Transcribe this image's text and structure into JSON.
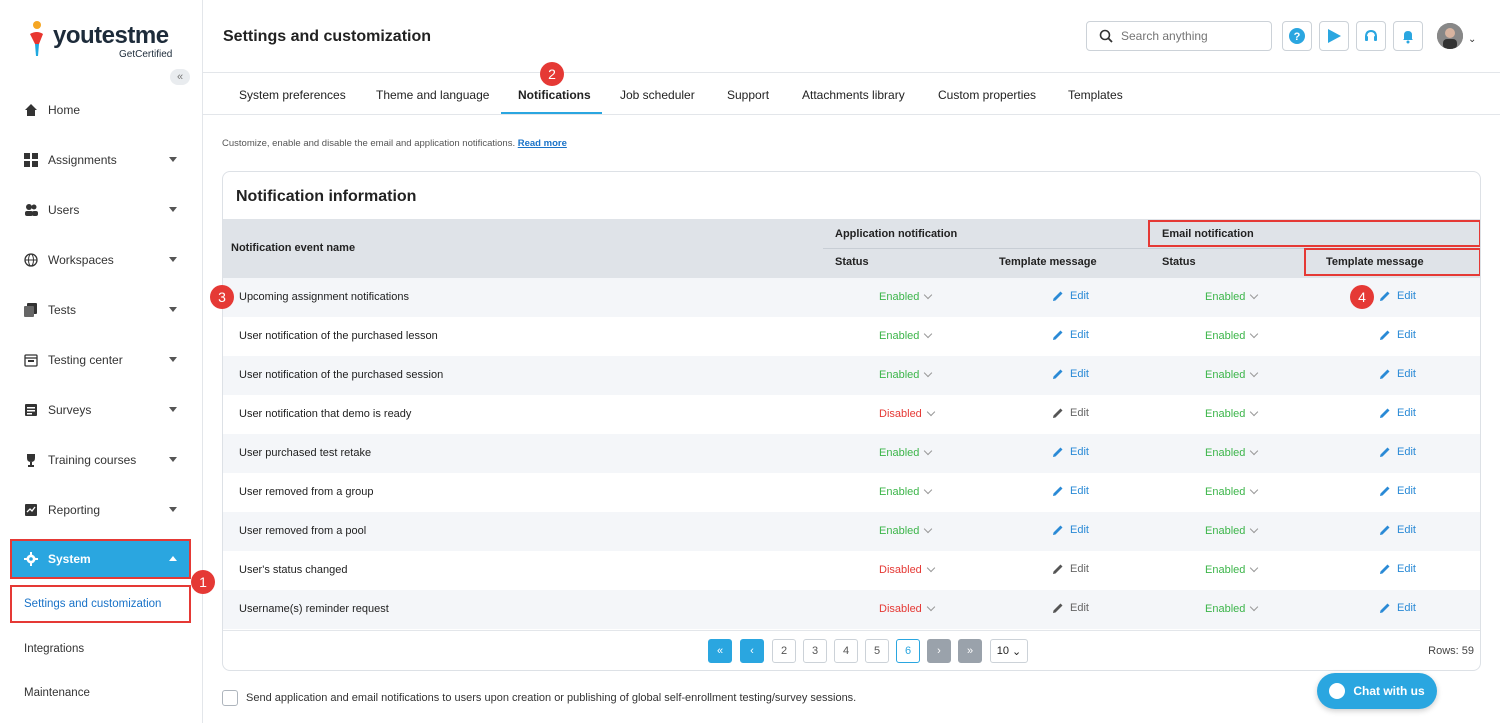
{
  "brand": {
    "name": "youtestme",
    "sub": "GetCertified"
  },
  "header": {
    "title": "Settings and customization",
    "search_placeholder": "Search anything"
  },
  "sidebar": {
    "items": [
      {
        "label": "Home"
      },
      {
        "label": "Assignments"
      },
      {
        "label": "Users"
      },
      {
        "label": "Workspaces"
      },
      {
        "label": "Tests"
      },
      {
        "label": "Testing center"
      },
      {
        "label": "Surveys"
      },
      {
        "label": "Training courses"
      },
      {
        "label": "Reporting"
      },
      {
        "label": "System"
      }
    ],
    "sub_items": [
      {
        "label": "Settings and customization"
      },
      {
        "label": "Integrations"
      },
      {
        "label": "Maintenance"
      }
    ]
  },
  "tabs": [
    {
      "label": "System preferences"
    },
    {
      "label": "Theme and language"
    },
    {
      "label": "Notifications"
    },
    {
      "label": "Job scheduler"
    },
    {
      "label": "Support"
    },
    {
      "label": "Attachments library"
    },
    {
      "label": "Custom properties"
    },
    {
      "label": "Templates"
    }
  ],
  "description": {
    "text": "Customize, enable and disable the email and application notifications. ",
    "link": "Read more"
  },
  "card": {
    "title": "Notification information",
    "columns": {
      "event_name": "Notification event name",
      "app_group": "Application notification",
      "email_group": "Email notification",
      "status": "Status",
      "template": "Template message"
    },
    "edit_label": "Edit",
    "rows": [
      {
        "name": "Upcoming assignment notifications",
        "app_status": "Enabled",
        "email_status": "Enabled"
      },
      {
        "name": "User notification of the purchased lesson",
        "app_status": "Enabled",
        "email_status": "Enabled"
      },
      {
        "name": "User notification of the purchased session",
        "app_status": "Enabled",
        "email_status": "Enabled"
      },
      {
        "name": "User notification that demo is ready",
        "app_status": "Disabled",
        "email_status": "Enabled"
      },
      {
        "name": "User purchased test retake",
        "app_status": "Enabled",
        "email_status": "Enabled"
      },
      {
        "name": "User removed from a group",
        "app_status": "Enabled",
        "email_status": "Enabled"
      },
      {
        "name": "User removed from a pool",
        "app_status": "Enabled",
        "email_status": "Enabled"
      },
      {
        "name": "User's status changed",
        "app_status": "Disabled",
        "email_status": "Enabled"
      },
      {
        "name": "Username(s) reminder request",
        "app_status": "Disabled",
        "email_status": "Enabled"
      }
    ]
  },
  "pagination": {
    "pages": [
      "2",
      "3",
      "4",
      "5",
      "6"
    ],
    "current": "6",
    "page_size": "10",
    "rows_label": "Rows: 59"
  },
  "footer_checkbox": "Send application and email notifications to users upon creation or publishing of global self-enrollment testing/survey sessions.",
  "chat": {
    "label": "Chat with us"
  },
  "badges": [
    "1",
    "2",
    "3",
    "4"
  ],
  "colors": {
    "accent": "#2aa6e0",
    "enabled": "#3cb54a",
    "disabled": "#e53935",
    "highlight": "#e53935"
  }
}
